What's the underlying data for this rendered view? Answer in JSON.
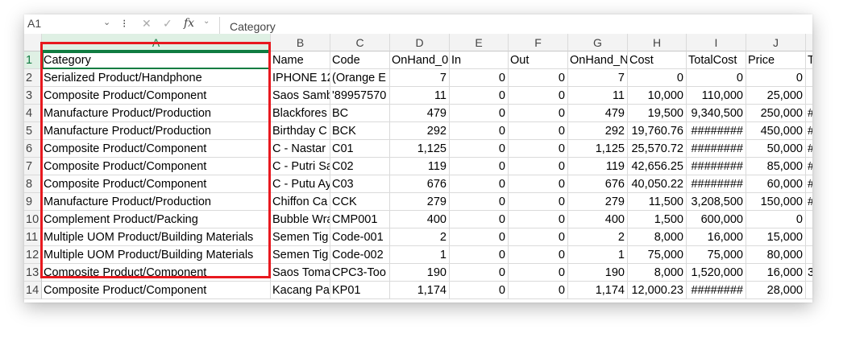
{
  "formula_bar": {
    "name_box": "A1",
    "fx_label": "fx",
    "content": "Category"
  },
  "columns": [
    "A",
    "B",
    "C",
    "D",
    "E",
    "F",
    "G",
    "H",
    "I",
    "J",
    ""
  ],
  "rows": [
    {
      "n": "1",
      "cells": [
        "Category",
        "Name",
        "Code",
        "OnHand_0",
        "In",
        "Out",
        "OnHand_N",
        "Cost",
        "TotalCost",
        "Price",
        "T"
      ]
    },
    {
      "n": "2",
      "cells": [
        "Serialized Product/Handphone",
        "IPHONE 12",
        "(Orange E",
        "7",
        "0",
        "0",
        "7",
        "0",
        "0",
        "0",
        ""
      ]
    },
    {
      "n": "3",
      "cells": [
        "Composite Product/Component",
        "Saos Samb",
        "'89957570",
        "11",
        "0",
        "0",
        "11",
        "10,000",
        "110,000",
        "25,000",
        ""
      ]
    },
    {
      "n": "4",
      "cells": [
        "Manufacture Product/Production",
        "Blackfores",
        "BC",
        "479",
        "0",
        "0",
        "479",
        "19,500",
        "9,340,500",
        "250,000",
        "#"
      ]
    },
    {
      "n": "5",
      "cells": [
        "Manufacture Product/Production",
        "Birthday C",
        "BCK",
        "292",
        "0",
        "0",
        "292",
        "19,760.76",
        "########",
        "450,000",
        "#"
      ]
    },
    {
      "n": "6",
      "cells": [
        "Composite Product/Component",
        "C - Nastar",
        "C01",
        "1,125",
        "0",
        "0",
        "1,125",
        "25,570.72",
        "########",
        "50,000",
        "#"
      ]
    },
    {
      "n": "7",
      "cells": [
        "Composite Product/Component",
        "C - Putri Sa",
        "C02",
        "119",
        "0",
        "0",
        "119",
        "42,656.25",
        "########",
        "85,000",
        "#"
      ]
    },
    {
      "n": "8",
      "cells": [
        "Composite Product/Component",
        "C - Putu Ay",
        "C03",
        "676",
        "0",
        "0",
        "676",
        "40,050.22",
        "########",
        "60,000",
        "#"
      ]
    },
    {
      "n": "9",
      "cells": [
        "Manufacture Product/Production",
        "Chiffon Ca",
        "CCK",
        "279",
        "0",
        "0",
        "279",
        "11,500",
        "3,208,500",
        "150,000",
        "#"
      ]
    },
    {
      "n": "10",
      "cells": [
        "Complement Product/Packing",
        "Bubble Wra",
        "CMP001",
        "400",
        "0",
        "0",
        "400",
        "1,500",
        "600,000",
        "0",
        ""
      ]
    },
    {
      "n": "11",
      "cells": [
        "Multiple UOM Product/Building Materials",
        "Semen Tig",
        "Code-001",
        "2",
        "0",
        "0",
        "2",
        "8,000",
        "16,000",
        "15,000",
        ""
      ]
    },
    {
      "n": "12",
      "cells": [
        "Multiple UOM Product/Building Materials",
        "Semen Tig",
        "Code-002",
        "1",
        "0",
        "0",
        "1",
        "75,000",
        "75,000",
        "80,000",
        ""
      ]
    },
    {
      "n": "13",
      "cells": [
        "Composite Product/Component",
        "Saos Toma",
        "CPC3-Too",
        "190",
        "0",
        "0",
        "190",
        "8,000",
        "1,520,000",
        "16,000",
        "3"
      ]
    },
    {
      "n": "14",
      "cells": [
        "Composite Product/Component",
        "Kacang Pan",
        "KP01",
        "1,174",
        "0",
        "0",
        "1,174",
        "12,000.23",
        "########",
        "28,000",
        ""
      ]
    }
  ]
}
